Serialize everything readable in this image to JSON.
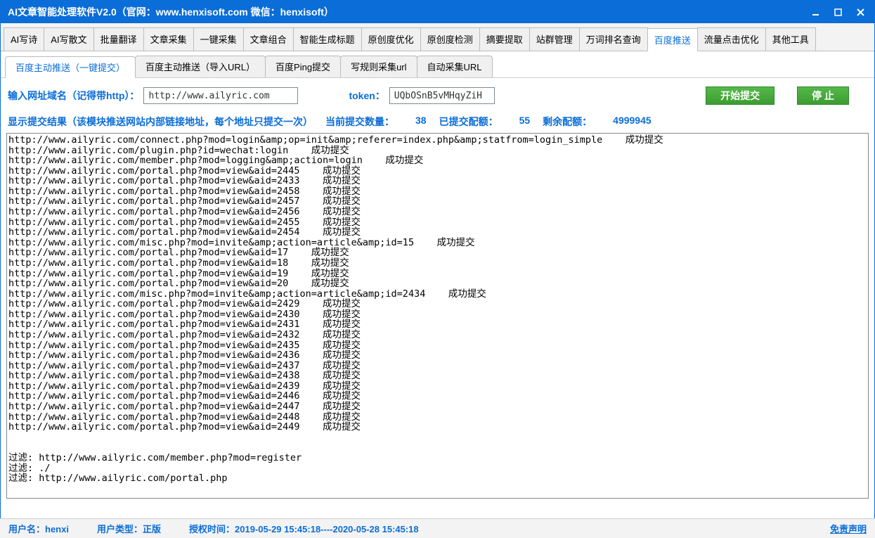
{
  "title": "AI文章智能处理软件V2.0（官网：www.henxisoft.com  微信：henxisoft）",
  "mainTabs": [
    "AI写诗",
    "AI写散文",
    "批量翻译",
    "文章采集",
    "一键采集",
    "文章组合",
    "智能生成标题",
    "原创度优化",
    "原创度检测",
    "摘要提取",
    "站群管理",
    "万词排名查询",
    "百度推送",
    "流量点击优化",
    "其他工具"
  ],
  "mainActive": 12,
  "subTabs": [
    "百度主动推送（一键提交）",
    "百度主动推送（导入URL）",
    "百度Ping提交",
    "写规则采集url",
    "自动采集URL"
  ],
  "subActive": 0,
  "form": {
    "urlLabel": "输入网址域名（记得带http）：",
    "urlValue": "http://www.ailyric.com",
    "tokenLabel": "token：",
    "tokenValue": "UQbOSnB5vMHqyZiH",
    "startBtn": "开始提交",
    "stopBtn": "停 止"
  },
  "result": {
    "headLabel": "显示提交结果（该模块推送网站内部链接地址，每个地址只提交一次）",
    "currLabel": "当前提交数量：",
    "currVal": "38",
    "doneLabel": "已提交配额：",
    "doneVal": "55",
    "leftLabel": "剩余配额：",
    "leftVal": "4999945"
  },
  "log": "http://www.ailyric.com/connect.php?mod=login&amp;op=init&amp;referer=index.php&amp;statfrom=login_simple    成功提交\nhttp://www.ailyric.com/plugin.php?id=wechat:login    成功提交\nhttp://www.ailyric.com/member.php?mod=logging&amp;action=login    成功提交\nhttp://www.ailyric.com/portal.php?mod=view&aid=2445    成功提交\nhttp://www.ailyric.com/portal.php?mod=view&aid=2433    成功提交\nhttp://www.ailyric.com/portal.php?mod=view&aid=2458    成功提交\nhttp://www.ailyric.com/portal.php?mod=view&aid=2457    成功提交\nhttp://www.ailyric.com/portal.php?mod=view&aid=2456    成功提交\nhttp://www.ailyric.com/portal.php?mod=view&aid=2455    成功提交\nhttp://www.ailyric.com/portal.php?mod=view&aid=2454    成功提交\nhttp://www.ailyric.com/misc.php?mod=invite&amp;action=article&amp;id=15    成功提交\nhttp://www.ailyric.com/portal.php?mod=view&aid=17    成功提交\nhttp://www.ailyric.com/portal.php?mod=view&aid=18    成功提交\nhttp://www.ailyric.com/portal.php?mod=view&aid=19    成功提交\nhttp://www.ailyric.com/portal.php?mod=view&aid=20    成功提交\nhttp://www.ailyric.com/misc.php?mod=invite&amp;action=article&amp;id=2434    成功提交\nhttp://www.ailyric.com/portal.php?mod=view&aid=2429    成功提交\nhttp://www.ailyric.com/portal.php?mod=view&aid=2430    成功提交\nhttp://www.ailyric.com/portal.php?mod=view&aid=2431    成功提交\nhttp://www.ailyric.com/portal.php?mod=view&aid=2432    成功提交\nhttp://www.ailyric.com/portal.php?mod=view&aid=2435    成功提交\nhttp://www.ailyric.com/portal.php?mod=view&aid=2436    成功提交\nhttp://www.ailyric.com/portal.php?mod=view&aid=2437    成功提交\nhttp://www.ailyric.com/portal.php?mod=view&aid=2438    成功提交\nhttp://www.ailyric.com/portal.php?mod=view&aid=2439    成功提交\nhttp://www.ailyric.com/portal.php?mod=view&aid=2446    成功提交\nhttp://www.ailyric.com/portal.php?mod=view&aid=2447    成功提交\nhttp://www.ailyric.com/portal.php?mod=view&aid=2448    成功提交\nhttp://www.ailyric.com/portal.php?mod=view&aid=2449    成功提交\n\n\n过滤: http://www.ailyric.com/member.php?mod=register\n过滤: ./\n过滤: http://www.ailyric.com/portal.php",
  "status": {
    "userLabel": "用户名：",
    "userVal": "henxi",
    "typeLabel": "用户类型：",
    "typeVal": "正版",
    "authLabel": "授权时间：",
    "authVal": "2019-05-29 15:45:18----2020-05-28 15:45:18",
    "disclaimer": "免责声明"
  }
}
